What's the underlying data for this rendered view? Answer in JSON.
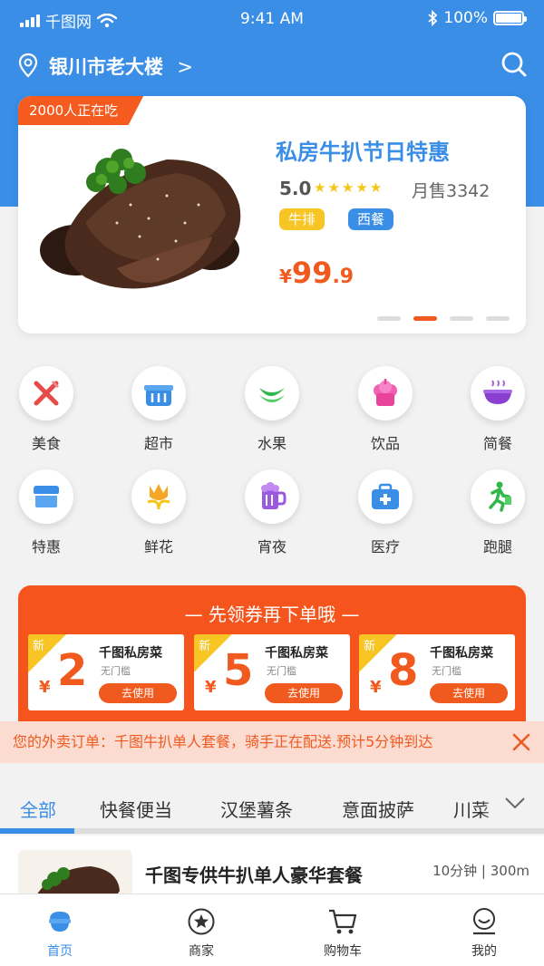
{
  "status_bar": {
    "carrier": "千图网",
    "time": "9:41 AM",
    "battery": "100%"
  },
  "location": {
    "name": "银川市老大楼",
    "chevron": ">"
  },
  "hero": {
    "badge": "2000人正在吃",
    "title": "私房牛扒节日特惠",
    "rating": "5.0",
    "stars": "★★★★★",
    "sales": "月售3342",
    "tags": [
      "牛排",
      "西餐"
    ],
    "price_symbol": "¥",
    "price_int": "99",
    "price_dec": ".9",
    "active_slide": 2,
    "slide_count": 4
  },
  "categories": [
    {
      "label": "美食",
      "icon": "fork-knife-icon"
    },
    {
      "label": "超市",
      "icon": "basket-icon"
    },
    {
      "label": "水果",
      "icon": "banana-icon"
    },
    {
      "label": "饮品",
      "icon": "drink-icon"
    },
    {
      "label": "简餐",
      "icon": "bowl-icon"
    },
    {
      "label": "特惠",
      "icon": "shop-icon"
    },
    {
      "label": "鲜花",
      "icon": "flower-icon"
    },
    {
      "label": "宵夜",
      "icon": "beer-icon"
    },
    {
      "label": "医疗",
      "icon": "medical-kit-icon"
    },
    {
      "label": "跑腿",
      "icon": "runner-icon"
    }
  ],
  "coupons": {
    "title": "—  先领券再下单哦  —",
    "items": [
      {
        "tag": "新",
        "yen": "¥",
        "amount": "2",
        "name": "千图私房菜",
        "cond": "无门槛",
        "button": "去使用"
      },
      {
        "tag": "新",
        "yen": "¥",
        "amount": "5",
        "name": "千图私房菜",
        "cond": "无门槛",
        "button": "去使用"
      },
      {
        "tag": "新",
        "yen": "¥",
        "amount": "8",
        "name": "千图私房菜",
        "cond": "无门槛",
        "button": "去使用"
      }
    ]
  },
  "notice": {
    "text": "您的外卖订单：千图牛扒单人套餐，骑手正在配送.预计5分钟到达"
  },
  "tabs": [
    "全部",
    "快餐便当",
    "汉堡薯条",
    "意面披萨",
    "川菜"
  ],
  "shop": {
    "name": "千图专供牛扒单人豪华套餐",
    "meta": "10分钟 | 300m"
  },
  "tabbar": [
    {
      "label": "首页",
      "icon": "home-bowl-icon",
      "active": true
    },
    {
      "label": "商家",
      "icon": "star-circle-icon",
      "active": false
    },
    {
      "label": "购物车",
      "icon": "cart-icon",
      "active": false
    },
    {
      "label": "我的",
      "icon": "profile-icon",
      "active": false
    }
  ],
  "colors": {
    "primary": "#3a8ee6",
    "accent": "#f05a1e",
    "yellow": "#f7c524"
  }
}
